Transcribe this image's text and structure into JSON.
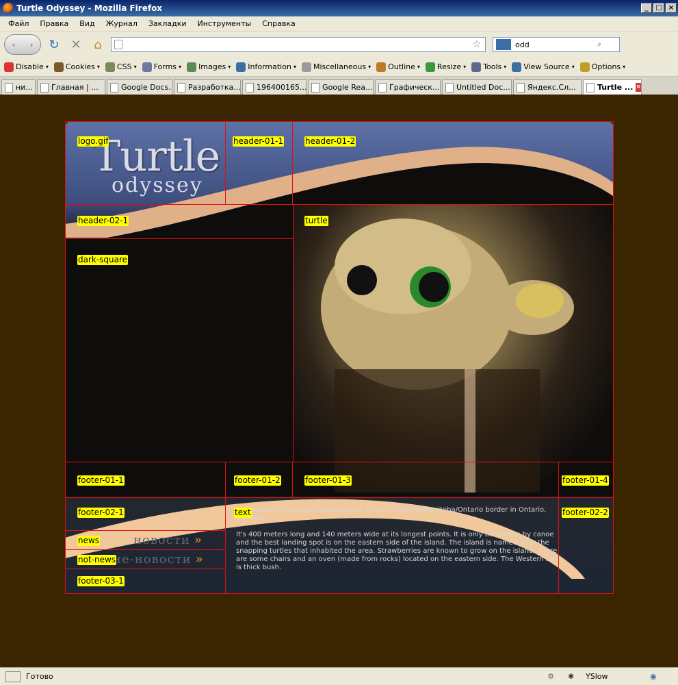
{
  "window": {
    "title": "Turtle Odyssey - Mozilla Firefox"
  },
  "menu": [
    "Файл",
    "Правка",
    "Вид",
    "Журнал",
    "Закладки",
    "Инструменты",
    "Справка"
  ],
  "nav": {
    "url": "",
    "search_value": "odd"
  },
  "devbar": [
    {
      "label": "Disable",
      "color": "#d33"
    },
    {
      "label": "Cookies",
      "color": "#7a5a2a"
    },
    {
      "label": "CSS",
      "color": "#7a8a5a"
    },
    {
      "label": "Forms",
      "color": "#6a7aa0"
    },
    {
      "label": "Images",
      "color": "#5a8a5a"
    },
    {
      "label": "Information",
      "color": "#3a6ea5"
    },
    {
      "label": "Miscellaneous",
      "color": "#9a9a9a"
    },
    {
      "label": "Outline",
      "color": "#c07a2a"
    },
    {
      "label": "Resize",
      "color": "#3a9a3a"
    },
    {
      "label": "Tools",
      "color": "#5a6a8a"
    },
    {
      "label": "View Source",
      "color": "#3a6ea5"
    },
    {
      "label": "Options",
      "color": "#c0a02a"
    }
  ],
  "tabs": [
    {
      "label": "ни..."
    },
    {
      "label": "Главная | ..."
    },
    {
      "label": "Google Docs..."
    },
    {
      "label": "Разработка..."
    },
    {
      "label": "196400165..."
    },
    {
      "label": "Google Rea..."
    },
    {
      "label": "Графическ..."
    },
    {
      "label": "Untitled Doc..."
    },
    {
      "label": "Яндекс.Сл..."
    },
    {
      "label": "Turtle ...",
      "active": true
    }
  ],
  "status": {
    "text": "Готово",
    "yslow": "YSlow"
  },
  "site": {
    "logo_big": "Turtle",
    "logo_small": "odyssey",
    "nav_news": "новости",
    "nav_not_news": "не-новости",
    "arrow": "»",
    "text_p1": "Turtle Island is a small island located 1.54km from the Manitoba/Ontario border in Ontario, Canada.",
    "text_p2": "It's 400 meters long and 140 meters wide at its longest points. It is only accessible by canoe and the best landing spot is on the eastern side of the island. The island is named after the snapping turtles that inhabited the area. Strawberries are known to grow on the island. There are some chairs and an oven (made from rocks) located on the eastern side. The Western side is thick bush."
  },
  "slice_labels": {
    "logo": "logo.gif",
    "header_01_1": "header-01-1",
    "header_01_2": "header-01-2",
    "header_02_1": "header-02-1",
    "turtle": "turtle",
    "dark_square": "dark-square",
    "footer_01_1": "footer-01-1",
    "footer_01_2": "footer-01-2",
    "footer_01_3": "footer-01-3",
    "footer_01_4": "footer-01-4",
    "footer_02_1": "footer-02-1",
    "text": "text",
    "footer_02_2": "footer-02-2",
    "news": "news",
    "not_news": "not-news",
    "footer_03_1": "footer-03-1"
  }
}
